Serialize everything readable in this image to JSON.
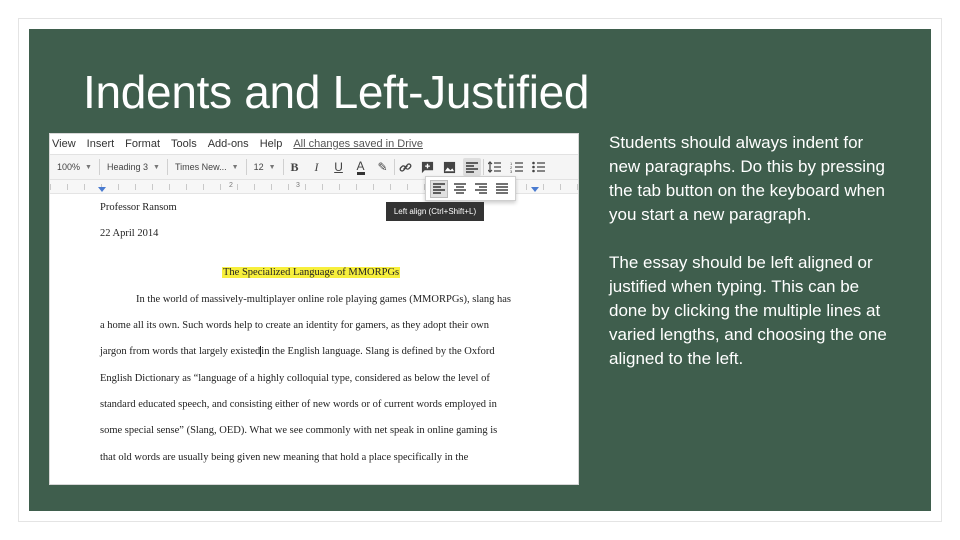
{
  "slide": {
    "title": "Indents and Left-Justified",
    "paragraphs": [
      "Students should always indent for new paragraphs. Do this by pressing the tab button on the keyboard when you start a new paragraph.",
      "The essay should be left aligned or justified when typing. This can be done by clicking the multiple lines at varied lengths, and choosing the one aligned to the left."
    ]
  },
  "editor": {
    "menu": [
      "View",
      "Insert",
      "Format",
      "Tools",
      "Add-ons",
      "Help"
    ],
    "saved_status": "All changes saved in Drive",
    "toolbar": {
      "zoom": "100%",
      "style": "Heading 3",
      "font": "Times New...",
      "size": "12"
    },
    "ruler": {
      "mark1": "2",
      "mark2": "3"
    },
    "tooltip": "Left align (Ctrl+Shift+L)",
    "document": {
      "name": "Professor Ransom",
      "date": "22 April 2014",
      "title": "The Specialized Language of MMORPGs",
      "line1": "In the world of massively-multiplayer online role playing games (MMORPGs), slang has",
      "line2": "a home all its own. Such words help to create an identity for gamers, as they adopt their own",
      "line3a": "jargon from words that largely existed",
      "line3b": "in the English language. Slang is defined by the Oxford",
      "line4": "English Dictionary as “language of a highly colloquial type, considered as below the level of",
      "line5": "standard educated speech, and consisting either of new words or of current words employed in",
      "line6": "some special sense” (Slang, OED). What we see commonly with net speak in online gaming is",
      "line7": "that old words are usually being given new meaning that hold a place specifically in the"
    }
  },
  "colors": {
    "slide_background": "#3f5e4d",
    "highlight": "#f7ef3c",
    "ruler_marker": "#4a7bd0"
  },
  "icons": {
    "toolbar": [
      "bold-icon",
      "italic-icon",
      "underline-icon",
      "text-color-icon",
      "highlight-pen-icon",
      "link-icon",
      "comment-icon",
      "image-icon",
      "align-left-icon",
      "line-spacing-icon",
      "numbered-list-icon",
      "bulleted-list-icon"
    ],
    "align_popup": [
      "align-left-icon",
      "align-center-icon",
      "align-right-icon",
      "justify-icon"
    ]
  }
}
